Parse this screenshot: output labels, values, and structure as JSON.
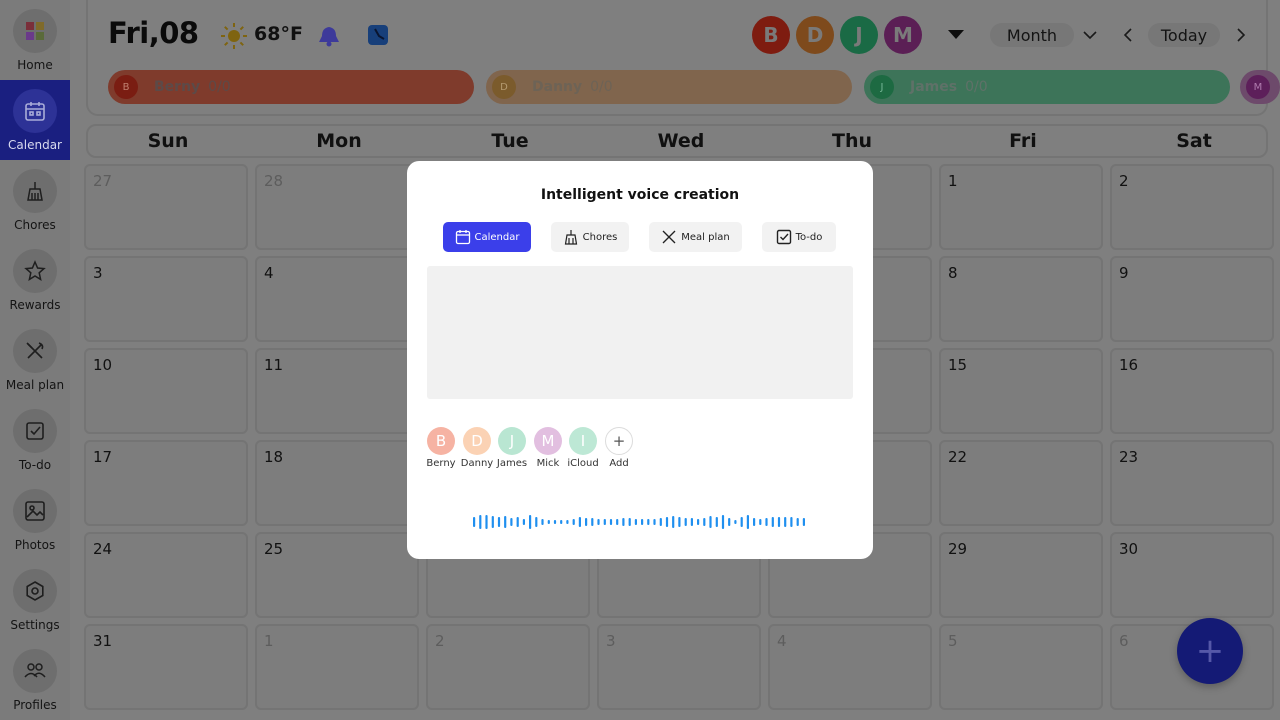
{
  "sidebar": {
    "items": [
      {
        "label": "Home",
        "icon": "home-icon"
      },
      {
        "label": "Calendar",
        "icon": "calendar-icon",
        "active": true
      },
      {
        "label": "Chores",
        "icon": "broom-icon"
      },
      {
        "label": "Rewards",
        "icon": "star-icon"
      },
      {
        "label": "Meal plan",
        "icon": "utensils-icon"
      },
      {
        "label": "To-do",
        "icon": "checkbox-icon"
      },
      {
        "label": "Photos",
        "icon": "photo-icon"
      },
      {
        "label": "Settings",
        "icon": "gear-icon"
      },
      {
        "label": "Profiles",
        "icon": "people-icon"
      }
    ]
  },
  "header": {
    "date": "Fri,08",
    "temperature": "68°F",
    "avatars": [
      {
        "initial": "B",
        "color": "#7e1c10"
      },
      {
        "initial": "D",
        "color": "#7e4a1c"
      },
      {
        "initial": "J",
        "color": "#1a6a45"
      },
      {
        "initial": "M",
        "color": "#5b1f55"
      }
    ],
    "view": "Month",
    "today": "Today"
  },
  "members": [
    {
      "initial": "B",
      "name": "Berny",
      "count": "0/0",
      "color": "#7f3b2c",
      "text": "#5c4a48"
    },
    {
      "initial": "D",
      "name": "Danny",
      "count": "0/0",
      "color": "#80654d",
      "text": "#6d6356"
    },
    {
      "initial": "J",
      "name": "James",
      "count": "0/0",
      "color": "#3d7459",
      "text": "#5f7168"
    },
    {
      "initial": "M",
      "name": "",
      "count": "",
      "color": "#6d4a6b",
      "text": "#5c4a5a"
    }
  ],
  "calendar": {
    "weekdays": [
      "Sun",
      "Mon",
      "Tue",
      "Wed",
      "Thu",
      "Fri",
      "Sat"
    ],
    "weeks": [
      [
        {
          "d": "27",
          "dim": true
        },
        {
          "d": "28",
          "dim": true
        },
        {
          "d": "",
          "dim": false
        },
        {
          "d": "",
          "dim": false
        },
        {
          "d": "",
          "dim": false
        },
        {
          "d": "1",
          "dim": false
        },
        {
          "d": "2",
          "dim": false
        }
      ],
      [
        {
          "d": "3",
          "dim": false
        },
        {
          "d": "4",
          "dim": false
        },
        {
          "d": "",
          "dim": false
        },
        {
          "d": "",
          "dim": false
        },
        {
          "d": "",
          "dim": false
        },
        {
          "d": "8",
          "dim": false
        },
        {
          "d": "9",
          "dim": false
        }
      ],
      [
        {
          "d": "10",
          "dim": false
        },
        {
          "d": "11",
          "dim": false
        },
        {
          "d": "",
          "dim": false
        },
        {
          "d": "",
          "dim": false
        },
        {
          "d": "",
          "dim": false
        },
        {
          "d": "15",
          "dim": false
        },
        {
          "d": "16",
          "dim": false
        }
      ],
      [
        {
          "d": "17",
          "dim": false
        },
        {
          "d": "18",
          "dim": false
        },
        {
          "d": "",
          "dim": false
        },
        {
          "d": "",
          "dim": false
        },
        {
          "d": "",
          "dim": false
        },
        {
          "d": "22",
          "dim": false
        },
        {
          "d": "23",
          "dim": false
        }
      ],
      [
        {
          "d": "24",
          "dim": false
        },
        {
          "d": "25",
          "dim": false
        },
        {
          "d": "",
          "dim": false
        },
        {
          "d": "",
          "dim": false
        },
        {
          "d": "",
          "dim": false
        },
        {
          "d": "29",
          "dim": false
        },
        {
          "d": "30",
          "dim": false
        }
      ],
      [
        {
          "d": "31",
          "dim": false
        },
        {
          "d": "1",
          "dim": true
        },
        {
          "d": "2",
          "dim": true
        },
        {
          "d": "3",
          "dim": true
        },
        {
          "d": "4",
          "dim": true
        },
        {
          "d": "5",
          "dim": true
        },
        {
          "d": "6",
          "dim": true
        }
      ]
    ]
  },
  "modal": {
    "title": "Intelligent voice creation",
    "tabs": [
      {
        "label": "Calendar",
        "icon": "calendar-icon",
        "active": true
      },
      {
        "label": "Chores",
        "icon": "broom-icon"
      },
      {
        "label": "Meal plan",
        "icon": "utensils-icon"
      },
      {
        "label": "To-do",
        "icon": "checkbox-icon"
      }
    ],
    "people": [
      {
        "initial": "B",
        "name": "Berny",
        "color": "#f6b3a3"
      },
      {
        "initial": "D",
        "name": "Danny",
        "color": "#fbd2b4"
      },
      {
        "initial": "J",
        "name": "James",
        "color": "#b9e6d2"
      },
      {
        "initial": "M",
        "name": "Mick",
        "color": "#e2bfe0"
      },
      {
        "initial": "I",
        "name": "iCloud",
        "color": "#bde8d5"
      }
    ],
    "add_label": "Add",
    "add_symbol": "+",
    "wave_color": "#1f8fef"
  },
  "fab_symbol": "+"
}
